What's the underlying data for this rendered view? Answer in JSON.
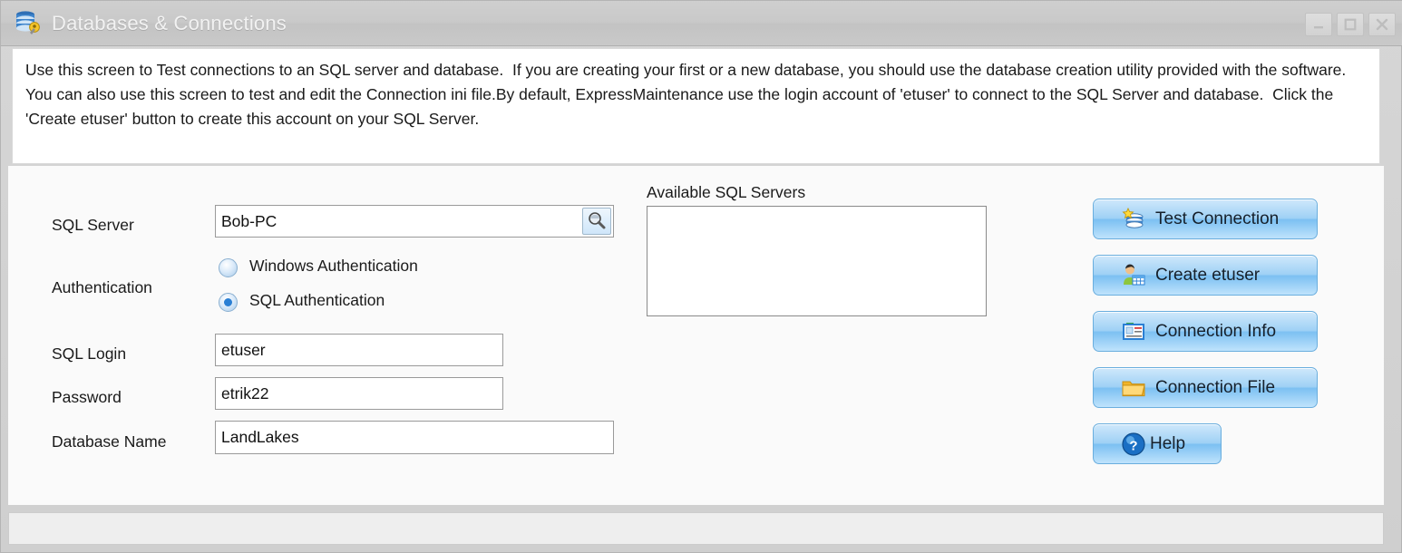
{
  "window": {
    "title": "Databases & Connections",
    "title_icon": "database-key-icon",
    "controls": {
      "minimize": "Minimize",
      "maximize": "Maximize",
      "close": "Close"
    }
  },
  "instructions": {
    "text": "Use this screen to Test connections to an SQL server and database.  If you are creating your first or a new database, you should use the database creation utility provided with the software.  You can also use this screen to test and edit the Connection ini file.By default, ExpressMaintenance use the login account of 'etuser' to connect to the SQL Server and database.  Click the 'Create etuser' button to create this account on your SQL Server."
  },
  "form": {
    "sql_server": {
      "label": "SQL Server",
      "value": "Bob-PC",
      "placeholder": "",
      "browse_icon": "magnifier-icon"
    },
    "authentication": {
      "label": "Authentication",
      "options": [
        {
          "label": "Windows Authentication",
          "selected": false
        },
        {
          "label": "SQL Authentication",
          "selected": true
        }
      ]
    },
    "sql_login": {
      "label": "SQL Login",
      "value": "etuser",
      "placeholder": ""
    },
    "password": {
      "label": "Password",
      "value": "etrik22",
      "placeholder": ""
    },
    "database_name": {
      "label": "Database Name",
      "value": "LandLakes",
      "placeholder": ""
    }
  },
  "available_servers": {
    "label": "Available SQL Servers",
    "items": []
  },
  "buttons": [
    {
      "label": "Test Connection",
      "icon": "database-star-icon"
    },
    {
      "label": "Create etuser",
      "icon": "user-table-icon"
    },
    {
      "label": "Connection Info",
      "icon": "id-card-icon"
    },
    {
      "label": "Connection File",
      "icon": "folder-icon"
    },
    {
      "label": "Help",
      "icon": "question-circle-icon"
    }
  ],
  "statusbar": {
    "text": ""
  },
  "colors": {
    "titlebar": "#c9c9c9",
    "button_accent": "#9fd1f5",
    "radio_selected": "#2a7fd4",
    "panel_background": "#fafafa",
    "instruction_background": "#ffffff"
  }
}
